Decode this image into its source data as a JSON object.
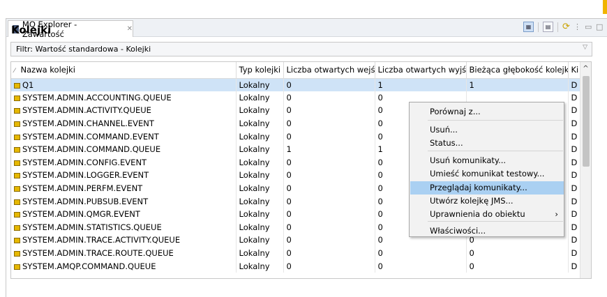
{
  "window": {
    "tab_title": "MQ Explorer - Zawartość",
    "tab_close": "✕"
  },
  "page": {
    "title": "Kolejki",
    "filter": "Filtr:  Wartość standardowa - Kolejki"
  },
  "table": {
    "columns": [
      "Nazwa kolejki",
      "Typ kolejki",
      "Liczba otwartych wejść",
      "Liczba otwartych wyjść",
      "Bieżąca głębokość kolejki",
      "Ki"
    ],
    "rows": [
      {
        "name": "Q1",
        "type": "Lokalny",
        "in": "0",
        "out": "1",
        "depth": "1",
        "k": "D"
      },
      {
        "name": "SYSTEM.ADMIN.ACCOUNTING.QUEUE",
        "type": "Lokalny",
        "in": "0",
        "out": "0",
        "depth": "",
        "k": "D"
      },
      {
        "name": "SYSTEM.ADMIN.ACTIVITY.QUEUE",
        "type": "Lokalny",
        "in": "0",
        "out": "0",
        "depth": "",
        "k": "D"
      },
      {
        "name": "SYSTEM.ADMIN.CHANNEL.EVENT",
        "type": "Lokalny",
        "in": "0",
        "out": "0",
        "depth": "",
        "k": "D"
      },
      {
        "name": "SYSTEM.ADMIN.COMMAND.EVENT",
        "type": "Lokalny",
        "in": "0",
        "out": "0",
        "depth": "",
        "k": "D"
      },
      {
        "name": "SYSTEM.ADMIN.COMMAND.QUEUE",
        "type": "Lokalny",
        "in": "1",
        "out": "1",
        "depth": "",
        "k": "D"
      },
      {
        "name": "SYSTEM.ADMIN.CONFIG.EVENT",
        "type": "Lokalny",
        "in": "0",
        "out": "0",
        "depth": "",
        "k": "D"
      },
      {
        "name": "SYSTEM.ADMIN.LOGGER.EVENT",
        "type": "Lokalny",
        "in": "0",
        "out": "0",
        "depth": "",
        "k": "D"
      },
      {
        "name": "SYSTEM.ADMIN.PERFM.EVENT",
        "type": "Lokalny",
        "in": "0",
        "out": "0",
        "depth": "",
        "k": "D"
      },
      {
        "name": "SYSTEM.ADMIN.PUBSUB.EVENT",
        "type": "Lokalny",
        "in": "0",
        "out": "0",
        "depth": "",
        "k": "D"
      },
      {
        "name": "SYSTEM.ADMIN.QMGR.EVENT",
        "type": "Lokalny",
        "in": "0",
        "out": "0",
        "depth": "",
        "k": "D"
      },
      {
        "name": "SYSTEM.ADMIN.STATISTICS.QUEUE",
        "type": "Lokalny",
        "in": "0",
        "out": "0",
        "depth": "0",
        "k": "D"
      },
      {
        "name": "SYSTEM.ADMIN.TRACE.ACTIVITY.QUEUE",
        "type": "Lokalny",
        "in": "0",
        "out": "0",
        "depth": "0",
        "k": "D"
      },
      {
        "name": "SYSTEM.ADMIN.TRACE.ROUTE.QUEUE",
        "type": "Lokalny",
        "in": "0",
        "out": "0",
        "depth": "0",
        "k": "D"
      },
      {
        "name": "SYSTEM.AMQP.COMMAND.QUEUE",
        "type": "Lokalny",
        "in": "0",
        "out": "0",
        "depth": "0",
        "k": "D"
      }
    ]
  },
  "context_menu": {
    "items": [
      {
        "label": "Porównaj z...",
        "highlighted": false,
        "submenu": false
      },
      {
        "label": "Usuń...",
        "highlighted": false,
        "submenu": false
      },
      {
        "label": "Status...",
        "highlighted": false,
        "submenu": false
      },
      {
        "label": "Usuń komunikaty...",
        "highlighted": false,
        "submenu": false
      },
      {
        "label": "Umieść komunikat testowy...",
        "highlighted": false,
        "submenu": false
      },
      {
        "label": "Przeglądaj komunikaty...",
        "highlighted": true,
        "submenu": false
      },
      {
        "label": "Utwórz kolejkę JMS...",
        "highlighted": false,
        "submenu": false
      },
      {
        "label": "Uprawnienia do obiektu",
        "highlighted": false,
        "submenu": true
      },
      {
        "label": "Właściwości...",
        "highlighted": false,
        "submenu": false
      }
    ]
  },
  "colors": {
    "selection": "#cfe3f7",
    "menu_highlight": "#aad0f2",
    "queue_icon": "#e6b800"
  }
}
